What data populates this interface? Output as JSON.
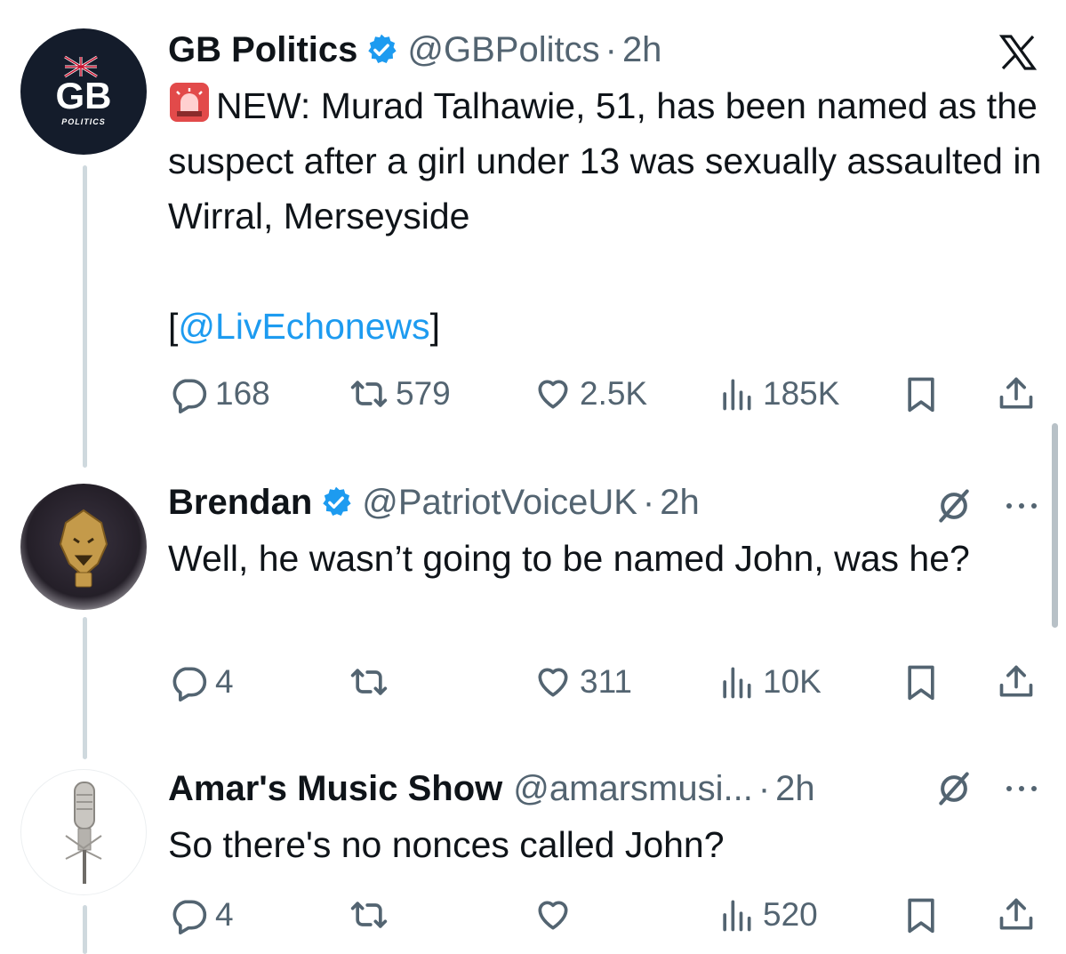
{
  "tweets": [
    {
      "author": "GB Politics",
      "handle": "@GBPolitcs",
      "separator": "·",
      "time": "2h",
      "avatar_text": "GB",
      "avatar_subtext": "POLITICS",
      "text_prefix": "NEW: Murad Talhawie, 51, has been named as the suspect after a girl under 13 was sexually assaulted in Wirral, Merseyside",
      "text_link_open": "[",
      "text_link": "@LivEchonews",
      "text_link_close": "]",
      "replies": "168",
      "reposts": "579",
      "likes": "2.5K",
      "views": "185K"
    },
    {
      "author": "Brendan",
      "handle": "@PatriotVoiceUK",
      "separator": "·",
      "time": "2h",
      "text": "Well, he wasn’t going to be named John, was he?",
      "replies": "4",
      "reposts": "",
      "likes": "311",
      "views": "10K"
    },
    {
      "author": "Amar's Music Show",
      "handle": "@amarsmusi...",
      "separator": "·",
      "time": "2h",
      "text": "So there's no nonces called John?",
      "replies": "4",
      "reposts": "",
      "likes": "",
      "views": "520"
    }
  ],
  "colors": {
    "verified": "#1d9bf0",
    "link": "#1d9bf0",
    "secondary_text": "#536471",
    "thread_line": "#cfd9de"
  },
  "icons": [
    "x-logo-icon",
    "verified-badge-icon",
    "siren-emoji-icon",
    "reply-icon",
    "repost-icon",
    "like-icon",
    "views-icon",
    "bookmark-icon",
    "share-icon",
    "grok-icon",
    "more-icon"
  ]
}
